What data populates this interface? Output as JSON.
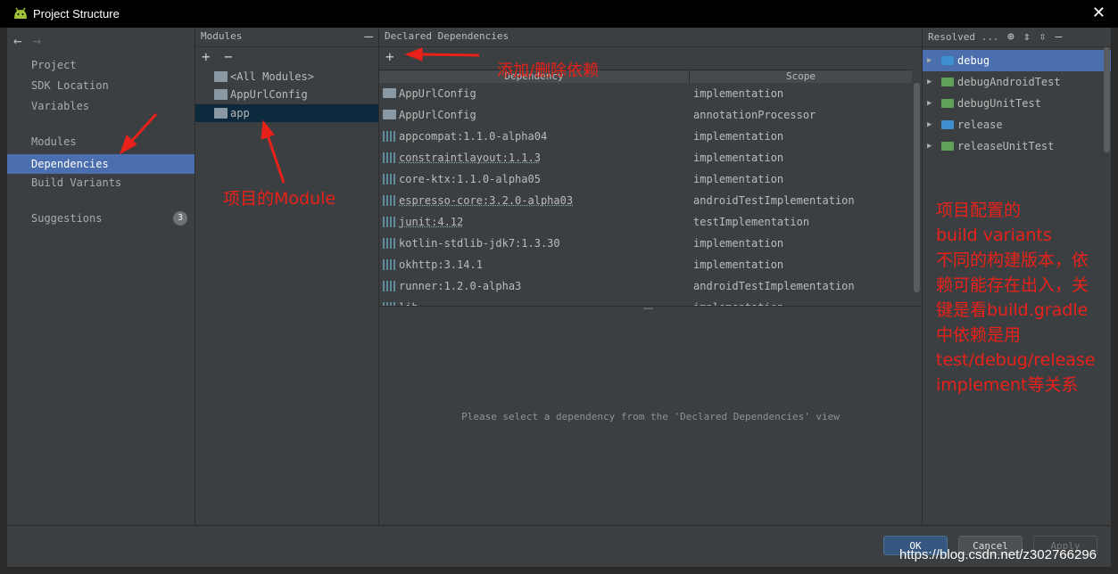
{
  "window": {
    "title": "Project Structure",
    "close_label": "✕"
  },
  "nav": {
    "back": "←",
    "forward": "→",
    "items": [
      {
        "label": "Project"
      },
      {
        "label": "SDK Location"
      },
      {
        "label": "Variables"
      },
      {
        "label": "Modules"
      },
      {
        "label": "Dependencies"
      },
      {
        "label": "Build Variants"
      },
      {
        "label": "Suggestions",
        "badge": "3"
      }
    ]
  },
  "modules": {
    "title": "Modules",
    "add": "+",
    "remove": "−",
    "collapse": "—",
    "items": [
      {
        "label": "<All Modules>"
      },
      {
        "label": "AppUrlConfig"
      },
      {
        "label": "app"
      }
    ]
  },
  "declared": {
    "title": "Declared Dependencies",
    "add": "+",
    "columns": {
      "dependency": "Dependency",
      "scope": "Scope"
    },
    "rows": [
      {
        "name": "AppUrlConfig",
        "scope": "implementation",
        "icon": "module-icon"
      },
      {
        "name": "AppUrlConfig",
        "scope": "annotationProcessor",
        "icon": "module-icon"
      },
      {
        "name": "appcompat:1.1.0-alpha04",
        "scope": "implementation",
        "icon": "library-icon"
      },
      {
        "name": "constraintlayout:1.1.3",
        "scope": "implementation",
        "icon": "library-icon"
      },
      {
        "name": "core-ktx:1.1.0-alpha05",
        "scope": "implementation",
        "icon": "library-icon"
      },
      {
        "name": "espresso-core:3.2.0-alpha03",
        "scope": "androidTestImplementation",
        "icon": "library-icon"
      },
      {
        "name": "junit:4.12",
        "scope": "testImplementation",
        "icon": "library-icon"
      },
      {
        "name": "kotlin-stdlib-jdk7:1.3.30",
        "scope": "implementation",
        "icon": "library-icon"
      },
      {
        "name": "okhttp:3.14.1",
        "scope": "implementation",
        "icon": "library-icon"
      },
      {
        "name": "runner:1.2.0-alpha3",
        "scope": "androidTestImplementation",
        "icon": "library-icon"
      },
      {
        "name": "lib...",
        "scope": "implementation",
        "icon": "library-icon"
      }
    ],
    "hint": "Please select a dependency from the 'Declared Dependencies' view"
  },
  "resolved": {
    "title": "Resolved ...",
    "items": [
      {
        "label": "debug",
        "color": "#3d8fd1"
      },
      {
        "label": "debugAndroidTest",
        "color": "#62a15a"
      },
      {
        "label": "debugUnitTest",
        "color": "#62a15a"
      },
      {
        "label": "release",
        "color": "#3d8fd1"
      },
      {
        "label": "releaseUnitTest",
        "color": "#62a15a"
      }
    ]
  },
  "buttons": {
    "ok": "OK",
    "cancel": "Cancel",
    "apply": "Apply"
  },
  "annotations": {
    "module": "项目的Module",
    "add_remove": "添加/删除依赖",
    "variants": [
      "项目配置的",
      "build variants",
      "不同的构建版本，依",
      "赖可能存在出入，关",
      "键是看build.gradle",
      "中依赖是用",
      "test/debug/release",
      "implement等关系"
    ]
  },
  "watermark": "https://blog.csdn.net/z302766296",
  "colors": {
    "accent": "#4b6eaf",
    "annotation": "#e8211a"
  }
}
